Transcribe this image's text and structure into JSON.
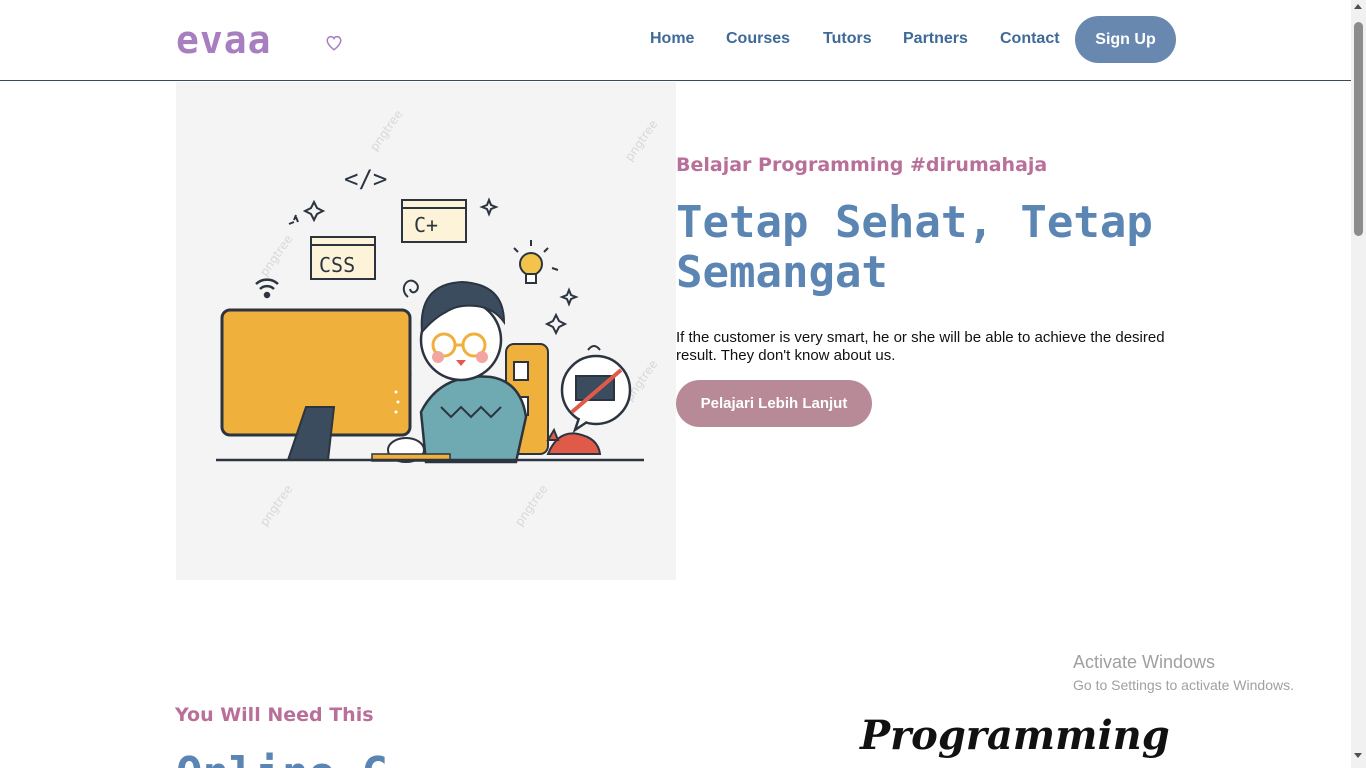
{
  "header": {
    "logo": "evaa",
    "nav": [
      "Home",
      "Courses",
      "Tutors",
      "Partners",
      "Contact"
    ],
    "signup_label": "Sign Up"
  },
  "hero": {
    "eyebrow": "Belajar Programming #dirumahaja",
    "title": "Tetap Sehat, Tetap Semangat",
    "text": "If the customer is very smart, he or she will be able to achieve the desired result. They don't know about us.",
    "cta_label": "Pelajari Lebih Lanjut",
    "illustration": {
      "code_tag": "</>",
      "css_label": "CSS",
      "cpp_label": "C+",
      "watermark": "pngtree"
    }
  },
  "section": {
    "eyebrow": "You Will Need This",
    "title": "Online C",
    "script_word": "Programming"
  },
  "watermark": {
    "line1": "Activate Windows",
    "line2": "Go to Settings to activate Windows."
  },
  "colors": {
    "logo": "#a77fc0",
    "nav": "#3e6a98",
    "signup_bg": "#6888b0",
    "accent_pink": "#b8709a",
    "title_blue": "#5b85b3",
    "cta_bg": "#b88a98"
  },
  "icons": [
    "heart-icon",
    "wifi-icon",
    "lightbulb-icon",
    "sparkle-icon"
  ]
}
